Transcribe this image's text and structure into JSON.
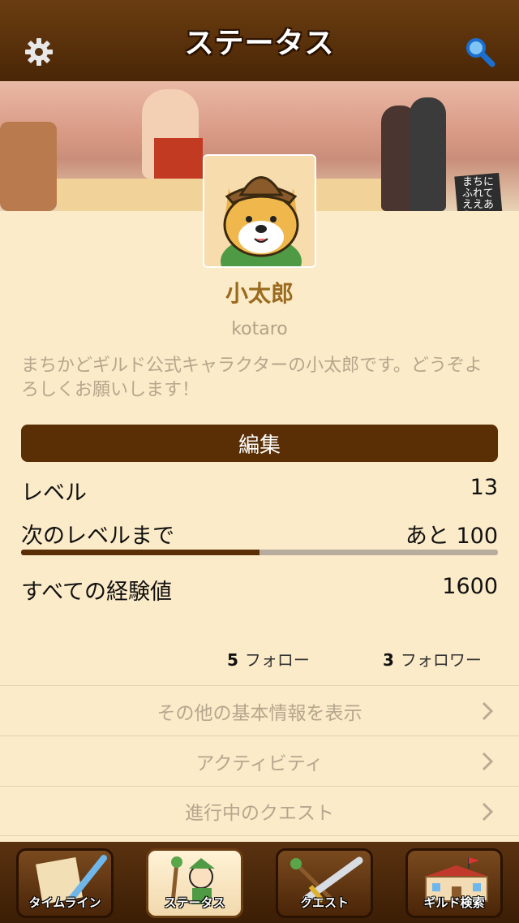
{
  "header": {
    "title": "ステータス",
    "settings_icon": "gear-icon",
    "search_icon": "search-icon"
  },
  "banner": {
    "sign_text": "まちにふれて ええあう ソーシャルギルディング"
  },
  "profile": {
    "name": "小太郎",
    "user_id": "kotaro",
    "bio": "まちかどギルド公式キャラクターの小太郎です。どうぞよろしくお願いします！",
    "edit_label": "編集"
  },
  "stats": {
    "level_label": "レベル",
    "level_value": "13",
    "next_label": "次のレベルまで",
    "next_value": "あと 100",
    "progress": 0.5,
    "exp_label": "すべての経験値",
    "exp_value": "1600"
  },
  "social": {
    "follow_count": "5",
    "follow_label": "フォロー",
    "follower_count": "3",
    "follower_label": "フォロワー"
  },
  "menu": [
    {
      "label": "その他の基本情報を表示"
    },
    {
      "label": "アクティビティ"
    },
    {
      "label": "進行中のクエスト"
    }
  ],
  "tabs": [
    {
      "label": "タイムライン",
      "icon": "scroll-quill-icon"
    },
    {
      "label": "ステータス",
      "icon": "character-icon"
    },
    {
      "label": "クエスト",
      "icon": "sword-icon"
    },
    {
      "label": "ギルド検索",
      "icon": "guild-hall-icon"
    }
  ],
  "colors": {
    "header": "#4a2606",
    "accent": "#5b2f06",
    "background": "#fcebc8",
    "name": "#9a6a1e"
  }
}
